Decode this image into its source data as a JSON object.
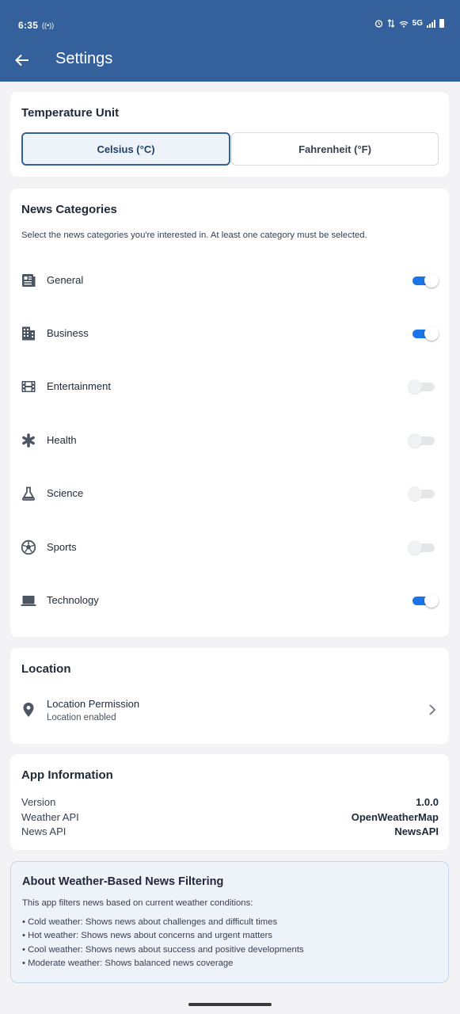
{
  "status_bar": {
    "time": "6:35",
    "network": "5G"
  },
  "header": {
    "title": "Settings"
  },
  "temperature": {
    "heading": "Temperature Unit",
    "options": [
      "Celsius (°C)",
      "Fahrenheit (°F)"
    ],
    "selected": "Celsius (°C)"
  },
  "news": {
    "heading": "News Categories",
    "description": "Select the news categories you're interested in. At least one category must be selected.",
    "categories": [
      {
        "label": "General",
        "icon": "newspaper-icon",
        "enabled": true
      },
      {
        "label": "Business",
        "icon": "building-icon",
        "enabled": true
      },
      {
        "label": "Entertainment",
        "icon": "film-icon",
        "enabled": false
      },
      {
        "label": "Health",
        "icon": "medical-asterisk-icon",
        "enabled": false
      },
      {
        "label": "Science",
        "icon": "flask-icon",
        "enabled": false
      },
      {
        "label": "Sports",
        "icon": "soccer-ball-icon",
        "enabled": false
      },
      {
        "label": "Technology",
        "icon": "laptop-icon",
        "enabled": true
      }
    ]
  },
  "location": {
    "heading": "Location",
    "permission_label": "Location Permission",
    "permission_status": "Location enabled"
  },
  "app_info": {
    "heading": "App Information",
    "rows": [
      {
        "key": "Version",
        "value": "1.0.0"
      },
      {
        "key": "Weather API",
        "value": "OpenWeatherMap"
      },
      {
        "key": "News API",
        "value": "NewsAPI"
      }
    ]
  },
  "about": {
    "heading": "About Weather-Based News Filtering",
    "intro": "This app filters news based on current weather conditions:",
    "items": [
      "• Cold weather: Shows news about challenges and difficult times",
      "• Hot weather: Shows news about concerns and urgent matters",
      "• Cool weather: Shows news about success and positive developments",
      "• Moderate weather: Shows balanced news coverage"
    ]
  },
  "colors": {
    "app_bar": "#34619b",
    "switch_on": "#1a73e8",
    "page_bg": "#f3f3f5"
  }
}
